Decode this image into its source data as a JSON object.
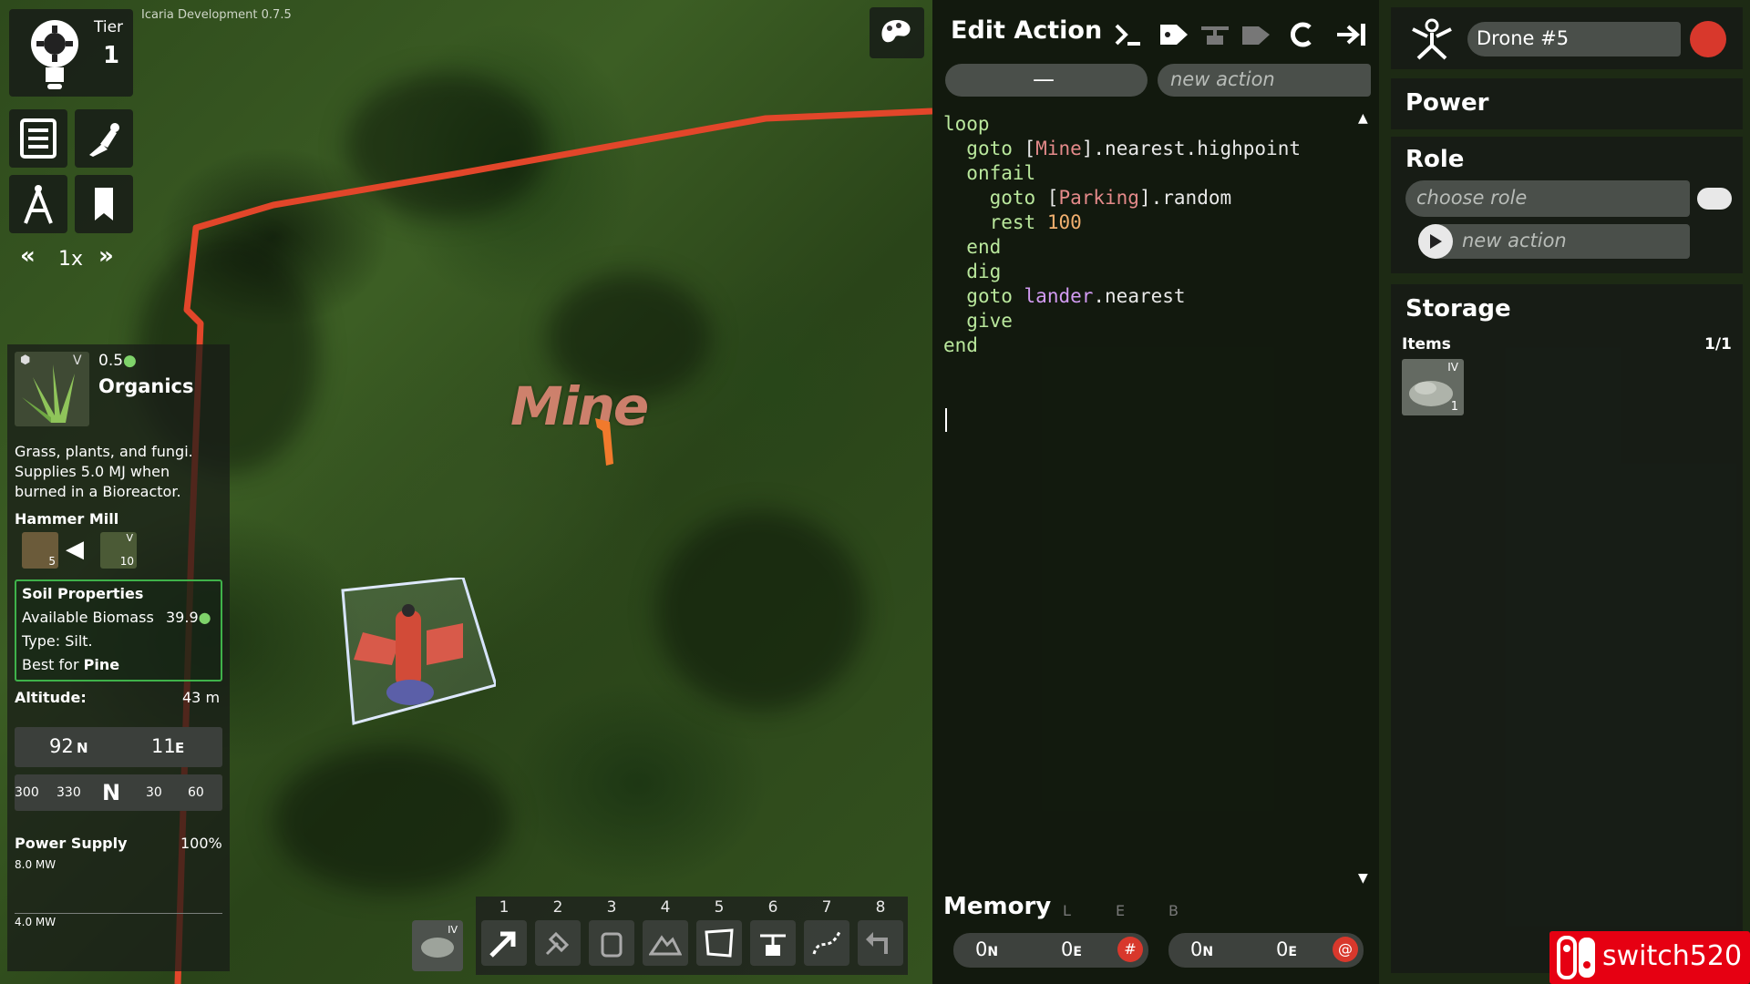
{
  "build": "Icaria Development 0.7.5",
  "tier": {
    "label": "Tier",
    "value": "1"
  },
  "speed": "1x",
  "item": {
    "grade": "V",
    "amount": "0.5",
    "name": "Organics",
    "description": [
      "Grass, plants, and fungi.",
      "Supplies 5.0 MJ when",
      "burned in a Bioreactor."
    ]
  },
  "recipe": {
    "title": "Hammer Mill",
    "output_count": "5",
    "input_grade": "V",
    "input_count": "10"
  },
  "soil": {
    "title": "Soil Properties",
    "biomass_label": "Available Biomass",
    "biomass_value": "39.9",
    "type": "Type: Silt.",
    "best_prefix": "Best for",
    "best_value": "Pine"
  },
  "altitude": {
    "label": "Altitude:",
    "value": "43 m"
  },
  "coords": {
    "n_value": "92",
    "n_unit": "N",
    "e_value": "11",
    "e_unit": "E"
  },
  "compass": [
    "300",
    "330",
    "N",
    "30",
    "60"
  ],
  "power_supply": {
    "label": "Power Supply",
    "percent": "100%",
    "high": "8.0 MW",
    "low": "4.0 MW"
  },
  "map_label": "Mine",
  "editor": {
    "title": "Edit Action",
    "minus": "—",
    "new_action_placeholder": "new action",
    "code": {
      "l1": "loop",
      "l2_kw": "goto",
      "l2_tag": "Mine",
      "l2_rest": ".nearest.highpoint",
      "l3": "onfail",
      "l4_kw": "goto",
      "l4_tag": "Parking",
      "l4_rest": ".random",
      "l5_kw": "rest",
      "l5_num": "100",
      "l6": "end",
      "l7": "dig",
      "l8_kw": "goto",
      "l8_ident": "lander",
      "l8_rest": ".nearest",
      "l9": "give",
      "l10": "end"
    },
    "memory": {
      "title": "Memory",
      "cols": [
        "L",
        "E",
        "B"
      ],
      "reg1": {
        "n": "0",
        "n_unit": "N",
        "e": "0",
        "e_unit": "E",
        "mark": "#"
      },
      "reg2": {
        "n": "0",
        "n_unit": "N",
        "e": "0",
        "e_unit": "E",
        "mark": "@"
      }
    }
  },
  "unit": {
    "name": "Drone #5",
    "power_title": "Power",
    "role_title": "Role",
    "role_placeholder": "choose role",
    "new_action": "new action",
    "storage_title": "Storage",
    "items_label": "Items",
    "items_count": "1/1",
    "item_grade": "IV",
    "item_qty": "1"
  },
  "toolbar": {
    "slot0_grade": "IV",
    "numbers": [
      "1",
      "2",
      "3",
      "4",
      "5",
      "6",
      "7",
      "8"
    ]
  },
  "watermark": "switch520",
  "colors": {
    "accent_red": "#d8382c",
    "route": "#e2462a",
    "soil_border": "#3fb24a"
  }
}
